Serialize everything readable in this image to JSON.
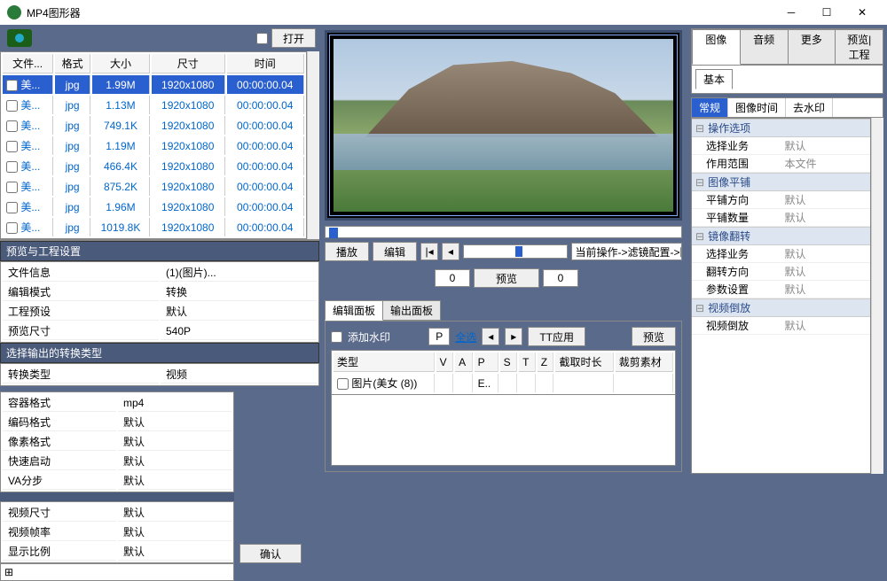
{
  "title": "MP4图形器",
  "open_btn": "打开",
  "file_table": {
    "cols": [
      "文件...",
      "格式",
      "大小",
      "尺寸",
      "时间"
    ],
    "rows": [
      {
        "name": "美...",
        "fmt": "jpg",
        "size": "1.99M",
        "dim": "1920x1080",
        "time": "00:00:00.04",
        "sel": true
      },
      {
        "name": "美...",
        "fmt": "jpg",
        "size": "1.13M",
        "dim": "1920x1080",
        "time": "00:00:00.04"
      },
      {
        "name": "美...",
        "fmt": "jpg",
        "size": "749.1K",
        "dim": "1920x1080",
        "time": "00:00:00.04"
      },
      {
        "name": "美...",
        "fmt": "jpg",
        "size": "1.19M",
        "dim": "1920x1080",
        "time": "00:00:00.04"
      },
      {
        "name": "美...",
        "fmt": "jpg",
        "size": "466.4K",
        "dim": "1920x1080",
        "time": "00:00:00.04"
      },
      {
        "name": "美...",
        "fmt": "jpg",
        "size": "875.2K",
        "dim": "1920x1080",
        "time": "00:00:00.04"
      },
      {
        "name": "美...",
        "fmt": "jpg",
        "size": "1.96M",
        "dim": "1920x1080",
        "time": "00:00:00.04"
      },
      {
        "name": "美...",
        "fmt": "jpg",
        "size": "1019.8K",
        "dim": "1920x1080",
        "time": "00:00:00.04"
      }
    ]
  },
  "preview_settings": {
    "header": "预览与工程设置",
    "rows": [
      [
        "文件信息",
        "(1)(图片)..."
      ],
      [
        "编辑模式",
        "转换"
      ],
      [
        "工程预设",
        "默认"
      ],
      [
        "预览尺寸",
        "540P"
      ]
    ]
  },
  "output_type": {
    "header": "选择输出的转换类型",
    "row": [
      "转换类型",
      "视频"
    ]
  },
  "codec_rows": [
    [
      "容器格式",
      "mp4"
    ],
    [
      "编码格式",
      "默认"
    ],
    [
      "像素格式",
      "默认"
    ],
    [
      "快速启动",
      "默认"
    ],
    [
      "VA分步",
      "默认"
    ]
  ],
  "video_rows": [
    [
      "视频尺寸",
      "默认"
    ],
    [
      "视频帧率",
      "默认"
    ],
    [
      "显示比例",
      "默认"
    ]
  ],
  "confirm_btn": "确认",
  "play_btn": "播放",
  "edit_btn": "编辑",
  "zero": "0",
  "path_text": "当前操作->滤镜配置->图像->常规",
  "preview_btn": "预览",
  "edit_panel_tab": "编辑面板",
  "output_panel_tab": "输出面板",
  "add_watermark": "添加水印",
  "p_label": "P",
  "select_all": "全选",
  "tt_apply": "TT应用",
  "media_cols": [
    "类型",
    "V",
    "A",
    "P",
    "S",
    "T",
    "Z",
    "截取时长",
    "裁剪素材"
  ],
  "media_row": {
    "type": "图片(美女 (8))",
    "p": "E.."
  },
  "top_tabs": [
    "图像",
    "音频",
    "更多",
    "预览|工程"
  ],
  "basic_tab": "基本",
  "sub_tabs": [
    "常规",
    "图像时间",
    "去水印"
  ],
  "prop_groups": [
    {
      "name": "操作选项",
      "rows": [
        [
          "选择业务",
          "默认"
        ],
        [
          "作用范围",
          "本文件"
        ]
      ]
    },
    {
      "name": "图像平铺",
      "rows": [
        [
          "平铺方向",
          "默认"
        ],
        [
          "平铺数量",
          "默认"
        ]
      ]
    },
    {
      "name": "镜像翻转",
      "rows": [
        [
          "选择业务",
          "默认"
        ],
        [
          "翻转方向",
          "默认"
        ],
        [
          "参数设置",
          "默认"
        ]
      ]
    },
    {
      "name": "视频倒放",
      "rows": [
        [
          "视频倒放",
          "默认"
        ]
      ]
    }
  ]
}
